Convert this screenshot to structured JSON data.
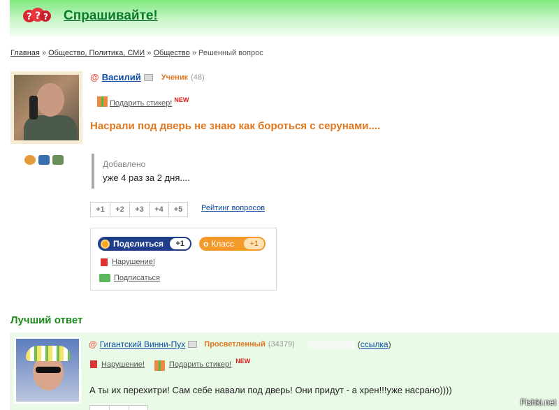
{
  "header": {
    "brand": "Спрашивайте!"
  },
  "breadcrumb": {
    "items": [
      "Главная",
      "Общество, Политика, СМИ",
      "Общество",
      "Решенный вопрос"
    ],
    "separator": "»"
  },
  "question_post": {
    "user_name": "Василий",
    "rank": "Ученик",
    "rank_score": "(48)",
    "sticker_link": "Подарить стикер!",
    "new_badge": "NEW",
    "title": "Насрали под дверь не знаю как бороться с серунами....",
    "added_label": "Добавлено",
    "added_text": "уже 4 раз за 2 дня....",
    "rating_buttons": [
      "+1",
      "+2",
      "+3",
      "+4",
      "+5"
    ],
    "rating_link": "Рейтинг вопросов",
    "share_label": "Поделиться",
    "share_count": "+1",
    "class_label": "Класс",
    "class_count": "+1",
    "report_link": "Нарушение!",
    "subscribe_link": "Подписаться"
  },
  "best_answer": {
    "heading": "Лучший ответ",
    "user_name": "Гигантский Винни-Пух",
    "rank": "Просветленный",
    "rank_score": "(34379)",
    "link_label": "ссылка",
    "report_link": "Нарушение!",
    "sticker_link": "Подарить стикер!",
    "new_badge": "NEW",
    "text": "А ты их перехитри! Сам себе навали под дверь! Они придут - а хрен!!!уже насрано))))"
  },
  "watermark": "Fishki.net",
  "colors": {
    "header_green": "#7fea7f",
    "brand_green": "#0a7a2a",
    "question_orange": "#e0761e",
    "link_blue": "#0c4aa6",
    "best_answer_green": "#1b8a1b",
    "answer_bg": "#e9fbe6"
  }
}
